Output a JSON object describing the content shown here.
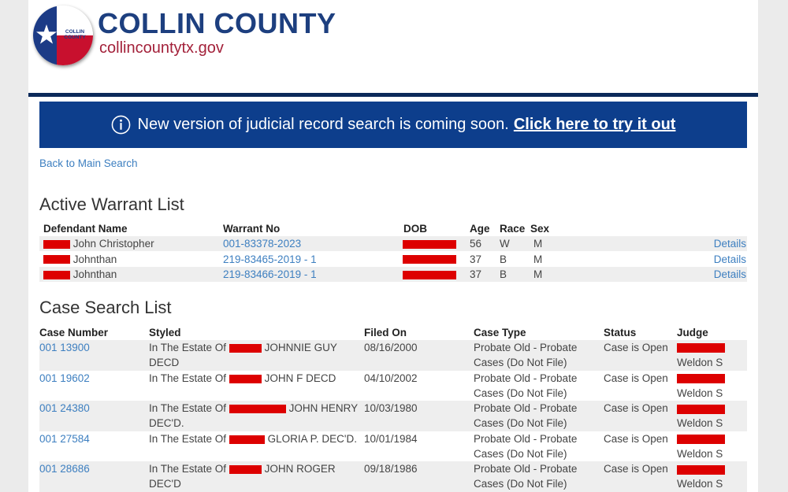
{
  "header": {
    "brand_name": "COLLIN COUNTY",
    "brand_url": "collincountytx.gov",
    "logo_small_text": "COLLIN COUNTY",
    "logo_icon": "texas-flag-star-icon"
  },
  "banner": {
    "message": "New version of judicial record search is coming soon.",
    "link_label": "Click here to try it out",
    "icon": "info-icon",
    "background": "#0d3e8c"
  },
  "back_link": "Back to Main Search",
  "warrants": {
    "title": "Active Warrant List",
    "columns": {
      "defendant": "Defendant Name",
      "warrant_no": "Warrant No",
      "dob": "DOB",
      "age": "Age",
      "race": "Race",
      "sex": "Sex"
    },
    "rows": [
      {
        "name": "John Christopher",
        "warrant_no": "001-83378-2023",
        "age": "56",
        "race": "W",
        "sex": "M",
        "details": "Details"
      },
      {
        "name": "Johnthan",
        "warrant_no": "219-83465-2019 - 1",
        "age": "37",
        "race": "B",
        "sex": "M",
        "details": "Details"
      },
      {
        "name": "Johnthan",
        "warrant_no": "219-83466-2019 - 1",
        "age": "37",
        "race": "B",
        "sex": "M",
        "details": "Details"
      }
    ]
  },
  "cases": {
    "title": "Case Search List",
    "columns": {
      "case_number": "Case Number",
      "styled": "Styled",
      "filed_on": "Filed On",
      "case_type": "Case Type",
      "status": "Status",
      "judge": "Judge"
    },
    "rows": [
      {
        "case_number": "001 13900",
        "styled_prefix": "In The Estate Of",
        "styled_suffix": "JOHNNIE GUY",
        "styled_line2": "DECD",
        "filed_on": "08/16/2000",
        "type_line1": "Probate Old - Probate",
        "type_line2": "Cases (Do Not File)",
        "status": "Case is Open",
        "judge": "Weldon S"
      },
      {
        "case_number": "001 19602",
        "styled_prefix": "In The Estate Of",
        "styled_suffix": "JOHN F DECD",
        "styled_line2": "",
        "filed_on": "04/10/2002",
        "type_line1": "Probate Old - Probate",
        "type_line2": "Cases (Do Not File)",
        "status": "Case is Open",
        "judge": "Weldon S"
      },
      {
        "case_number": "001 24380",
        "styled_prefix": "In The Estate Of",
        "styled_suffix": "JOHN HENRY",
        "styled_line2": "DEC'D.",
        "filed_on": "10/03/1980",
        "type_line1": "Probate Old - Probate",
        "type_line2": "Cases (Do Not File)",
        "status": "Case is Open",
        "judge": "Weldon S"
      },
      {
        "case_number": "001 27584",
        "styled_prefix": "In The Estate Of",
        "styled_suffix": "GLORIA P. DEC'D.",
        "styled_line2": "",
        "filed_on": "10/01/1984",
        "type_line1": "Probate Old - Probate",
        "type_line2": "Cases (Do Not File)",
        "status": "Case is Open",
        "judge": "Weldon S"
      },
      {
        "case_number": "001 28686",
        "styled_prefix": "In The Estate Of",
        "styled_suffix": "JOHN ROGER",
        "styled_line2": "DEC'D",
        "filed_on": "09/18/1986",
        "type_line1": "Probate Old - Probate",
        "type_line2": "Cases (Do Not File)",
        "status": "Case is Open",
        "judge": "Weldon S"
      }
    ]
  },
  "colors": {
    "link": "#3d7fc0",
    "redaction": "#dd0000",
    "brand_blue": "#1d3f7f",
    "brand_red": "#a3213a",
    "header_rule": "#0c2a5a"
  }
}
